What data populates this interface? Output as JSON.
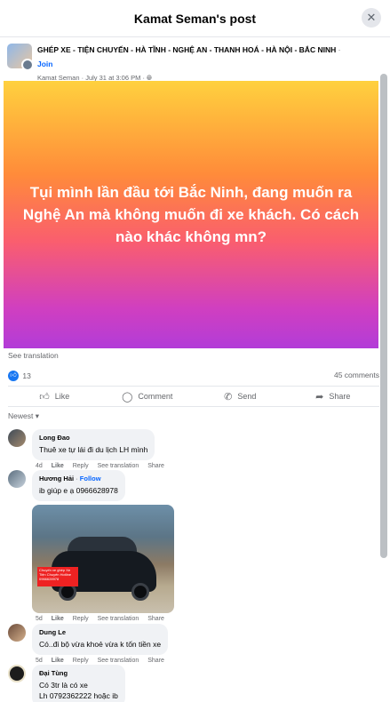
{
  "header": {
    "title": "Kamat Seman's post",
    "close_icon": "close-icon"
  },
  "post": {
    "group_name": "GHÉP XE - TIỆN CHUYẾN - HÀ TĨNH - NGHỆ AN - THANH HOÁ - HÀ NỘI - BẮC NINH",
    "separator": "·",
    "join_label": "Join",
    "author": "Kamat Seman",
    "date": "July 31 at 3:06 PM",
    "privacy_icon": "globe-icon",
    "banner_text": "Tụi mình lần đầu tới Bắc Ninh, đang muốn ra Nghệ An mà không muốn đi xe khách. Có cách nào khác không mn?",
    "see_translation": "See translation",
    "reaction_count": "13",
    "comment_count": "45 comments",
    "actions": {
      "like": "Like",
      "comment": "Comment",
      "send": "Send",
      "share": "Share"
    },
    "sort_label": "Newest"
  },
  "comments": [
    {
      "name": "Long Đao",
      "text": "Thuê xe tự lái đi du lịch LH mình",
      "time": "4d",
      "like": "Like",
      "reply": "Reply",
      "translate": "See translation",
      "share": "Share"
    },
    {
      "name": "Hương Hải",
      "follow": "Follow",
      "text": "ib giúp e ạ 0966628978",
      "image_caption": "Chuyến xe ghép Xe Tiện Chuyến Hotline 0966628978",
      "time": "5d",
      "like": "Like",
      "reply": "Reply",
      "translate": "See translation",
      "share": "Share"
    },
    {
      "name": "Dung Le",
      "text": "Có..đi bộ vừa khoẻ vừa k tốn tiền xe",
      "time": "5d",
      "like": "Like",
      "reply": "Reply",
      "translate": "See translation",
      "share": "Share"
    },
    {
      "name": "Đại Tùng",
      "text1": "Có 3tr là có xe",
      "text2": "Lh 0792362222 hoặc ib"
    }
  ]
}
